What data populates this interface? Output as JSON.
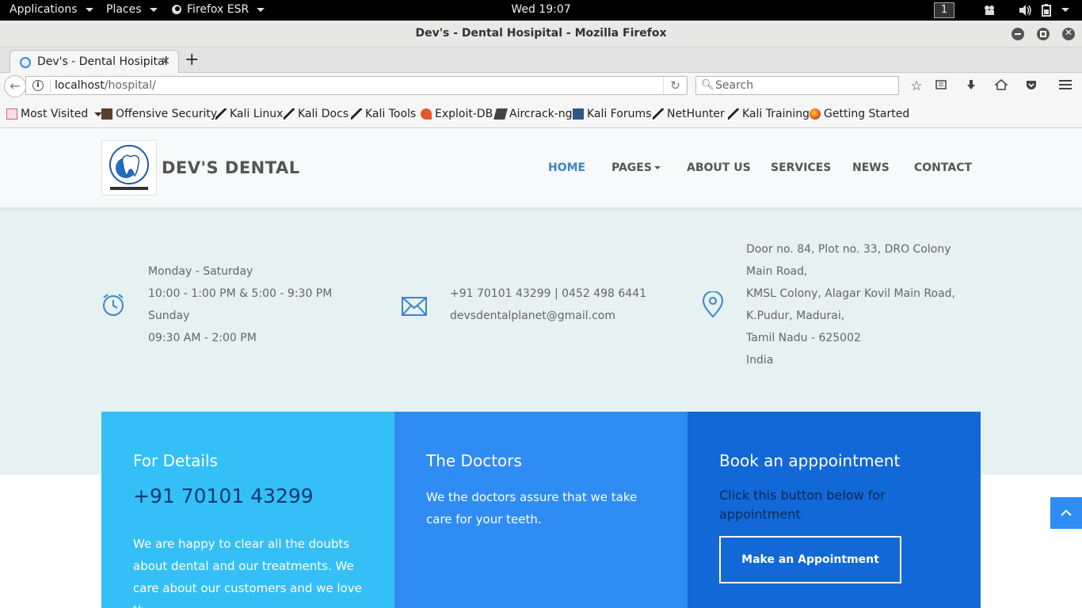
{
  "system": {
    "applications": "Applications",
    "places": "Places",
    "browser_app": "Firefox ESR",
    "clock": "Wed 19:07",
    "workspace": "1"
  },
  "window": {
    "title": "Dev's - Dental Hosipital - Mozilla Firefox"
  },
  "tabs": [
    {
      "label": "Dev's - Dental Hosipital",
      "close": "×"
    }
  ],
  "newtab": "+",
  "navbar": {
    "url_host": "localhost",
    "url_path": "/hospital/",
    "search_placeholder": "Search"
  },
  "bookmarks": [
    {
      "label": "Most Visited",
      "icon": "most-visited-icon"
    },
    {
      "label": "Offensive Security",
      "icon": "offsec-icon"
    },
    {
      "label": "Kali Linux",
      "icon": "kali-icon"
    },
    {
      "label": "Kali Docs",
      "icon": "kali-icon"
    },
    {
      "label": "Kali Tools",
      "icon": "kali-icon"
    },
    {
      "label": "Exploit-DB",
      "icon": "exploitdb-icon"
    },
    {
      "label": "Aircrack-ng",
      "icon": "aircrack-icon"
    },
    {
      "label": "Kali Forums",
      "icon": "forum-icon"
    },
    {
      "label": "NetHunter",
      "icon": "kali-icon"
    },
    {
      "label": "Kali Training",
      "icon": "kali-icon"
    },
    {
      "label": "Getting Started",
      "icon": "firefox-icon"
    }
  ],
  "site": {
    "brand": "DEV'S DENTAL",
    "menu": [
      "HOME",
      "PAGES",
      "ABOUT US",
      "SERVICES",
      "NEWS",
      "CONTACT"
    ],
    "accent": "#3d85c6",
    "hours": [
      "Monday - Saturday",
      "10:00 - 1:00 PM & 5:00 - 9:30 PM",
      "Sunday",
      "09:30 AM - 2:00 PM"
    ],
    "contact": [
      "+91 70101 43299 | 0452 498 6441",
      "devsdentalplanet@gmail.com"
    ],
    "address": [
      "Door no. 84, Plot no. 33, DRO Colony",
      "Main Road,",
      "KMSL Colony, Alagar Kovil Main Road,",
      "K.Pudur, Madurai,",
      "Tamil Nadu - 625002",
      "India"
    ],
    "cards": {
      "details": {
        "title": "For Details",
        "phone": "+91 70101 43299",
        "text": "We are happy to clear all the doubts about dental and our treatments. We care about our customers and we love th..."
      },
      "doctors": {
        "title": "The Doctors",
        "text": "We the doctors assure that we take care for your teeth."
      },
      "appointment": {
        "title": "Book an apppointment",
        "text": "Click this button below for appointment",
        "button": "Make an Appointment"
      }
    }
  }
}
